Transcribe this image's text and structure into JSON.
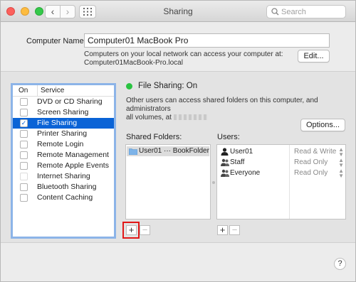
{
  "window": {
    "title": "Sharing"
  },
  "search": {
    "placeholder": "Search"
  },
  "computer_name": {
    "label": "Computer Name:",
    "value": "Computer01 MacBook Pro",
    "note_line1": "Computers on your local network can access your computer at:",
    "note_line2": "Computer01MacBook-Pro.local",
    "edit_label": "Edit..."
  },
  "services": {
    "header_on": "On",
    "header_service": "Service",
    "items": [
      {
        "label": "DVD or CD Sharing",
        "checked": false
      },
      {
        "label": "Screen Sharing",
        "checked": false
      },
      {
        "label": "File Sharing",
        "checked": true,
        "selected": true
      },
      {
        "label": "Printer Sharing",
        "checked": false
      },
      {
        "label": "Remote Login",
        "checked": false
      },
      {
        "label": "Remote Management",
        "checked": false
      },
      {
        "label": "Remote Apple Events",
        "checked": false
      },
      {
        "label": "Internet Sharing",
        "checked": false,
        "disabled": true
      },
      {
        "label": "Bluetooth Sharing",
        "checked": false
      },
      {
        "label": "Content Caching",
        "checked": false
      }
    ]
  },
  "status": {
    "text": "File Sharing: On",
    "desc_line1": "Other users can access shared folders on this computer, and administrators",
    "desc_line2": "all volumes, at",
    "dot_color": "#29c341"
  },
  "options_label": "Options...",
  "shared_folders": {
    "label": "Shared Folders:",
    "items": [
      {
        "name": "User01 ··· BookFolder"
      }
    ]
  },
  "users": {
    "label": "Users:",
    "items": [
      {
        "name": "User01",
        "icon": "user-icon",
        "permission": "Read & Write"
      },
      {
        "name": "Staff",
        "icon": "group-icon",
        "permission": "Read Only"
      },
      {
        "name": "Everyone",
        "icon": "group-icon",
        "permission": "Read Only"
      }
    ]
  },
  "buttons": {
    "plus": "+",
    "minus": "−",
    "help": "?"
  },
  "colors": {
    "selection": "#0a63d6",
    "highlight_box": "#e11818",
    "list_focus": "#8cb4e8"
  }
}
